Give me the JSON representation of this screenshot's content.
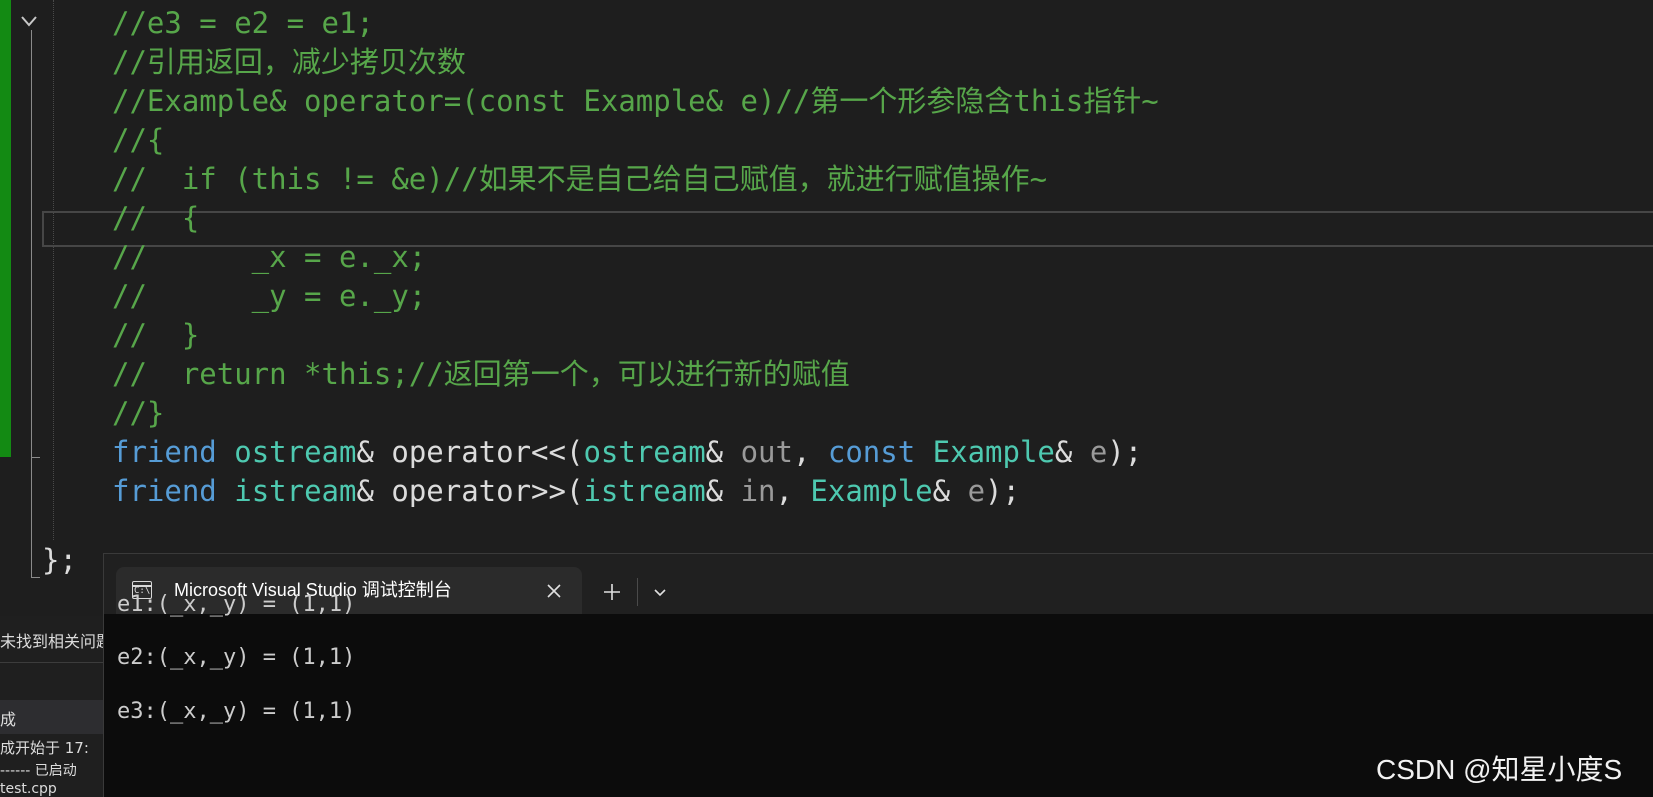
{
  "editor": {
    "lines": [
      [
        {
          "t": "//e3 = e2 = e1;",
          "c": "comment"
        }
      ],
      [
        {
          "t": "//引用返回，减少拷贝次数",
          "c": "comment"
        }
      ],
      [
        {
          "t": "//Example& operator=(const Example& e)//第一个形参隐含this指针~",
          "c": "comment"
        }
      ],
      [
        {
          "t": "//{",
          "c": "comment"
        }
      ],
      [
        {
          "t": "//  if (this != &e)//如果不是自己给自己赋值，就进行赋值操作~",
          "c": "comment"
        }
      ],
      [
        {
          "t": "//  {",
          "c": "comment"
        }
      ],
      [
        {
          "t": "//      _x = e._x;",
          "c": "comment"
        }
      ],
      [
        {
          "t": "//      _y = e._y;",
          "c": "comment"
        }
      ],
      [
        {
          "t": "//  }",
          "c": "comment"
        }
      ],
      [
        {
          "t": "//  return *this;//返回第一个，可以进行新的赋值",
          "c": "comment"
        }
      ],
      [
        {
          "t": "//}",
          "c": "comment"
        }
      ],
      [
        {
          "t": "friend",
          "c": "kw"
        },
        {
          "t": " ",
          "c": "plain"
        },
        {
          "t": "ostream",
          "c": "type"
        },
        {
          "t": "& operator<<(",
          "c": "plain"
        },
        {
          "t": "ostream",
          "c": "type"
        },
        {
          "t": "& ",
          "c": "plain"
        },
        {
          "t": "out",
          "c": "param"
        },
        {
          "t": ", ",
          "c": "plain"
        },
        {
          "t": "const",
          "c": "kw"
        },
        {
          "t": " ",
          "c": "plain"
        },
        {
          "t": "Example",
          "c": "type"
        },
        {
          "t": "& ",
          "c": "plain"
        },
        {
          "t": "e",
          "c": "param"
        },
        {
          "t": ");",
          "c": "plain"
        }
      ],
      [
        {
          "t": "friend",
          "c": "kw"
        },
        {
          "t": " ",
          "c": "plain"
        },
        {
          "t": "istream",
          "c": "type"
        },
        {
          "t": "& operator>>(",
          "c": "plain"
        },
        {
          "t": "istream",
          "c": "type"
        },
        {
          "t": "& ",
          "c": "plain"
        },
        {
          "t": "in",
          "c": "param"
        },
        {
          "t": ", ",
          "c": "plain"
        },
        {
          "t": "Example",
          "c": "type"
        },
        {
          "t": "& ",
          "c": "plain"
        },
        {
          "t": "e",
          "c": "param"
        },
        {
          "t": ");",
          "c": "plain"
        }
      ]
    ],
    "class_end": "};"
  },
  "left_panel": {
    "status_text": "未找到相关问题",
    "output_header": "成",
    "output_lines": [
      "成开始于 17:",
      "------ 已启动",
      "test.cpp"
    ]
  },
  "terminal": {
    "tab_title": "Microsoft Visual Studio 调试控制台",
    "tab_icon_glyph": "C:\\",
    "icons": {
      "close": "close-icon",
      "new_tab": "plus-icon",
      "dropdown": "chevron-down-icon",
      "tab": "console-icon",
      "fold": "chevron-down-icon"
    },
    "lines": [
      "e1:(_x,_y) = (1,1)",
      "e2:(_x,_y) = (1,1)",
      "e3:(_x,_y) = (1,1)"
    ]
  },
  "watermark": "CSDN @知星小度S",
  "colors": {
    "comment": "#57a64a",
    "keyword": "#569cd6",
    "type": "#4ec9b0",
    "plain": "#dcdcdc",
    "param": "#9a9a9a",
    "change_bar": "#138a13",
    "terminal_bg": "#0c0c0c",
    "titlebar_bg": "#202020"
  }
}
